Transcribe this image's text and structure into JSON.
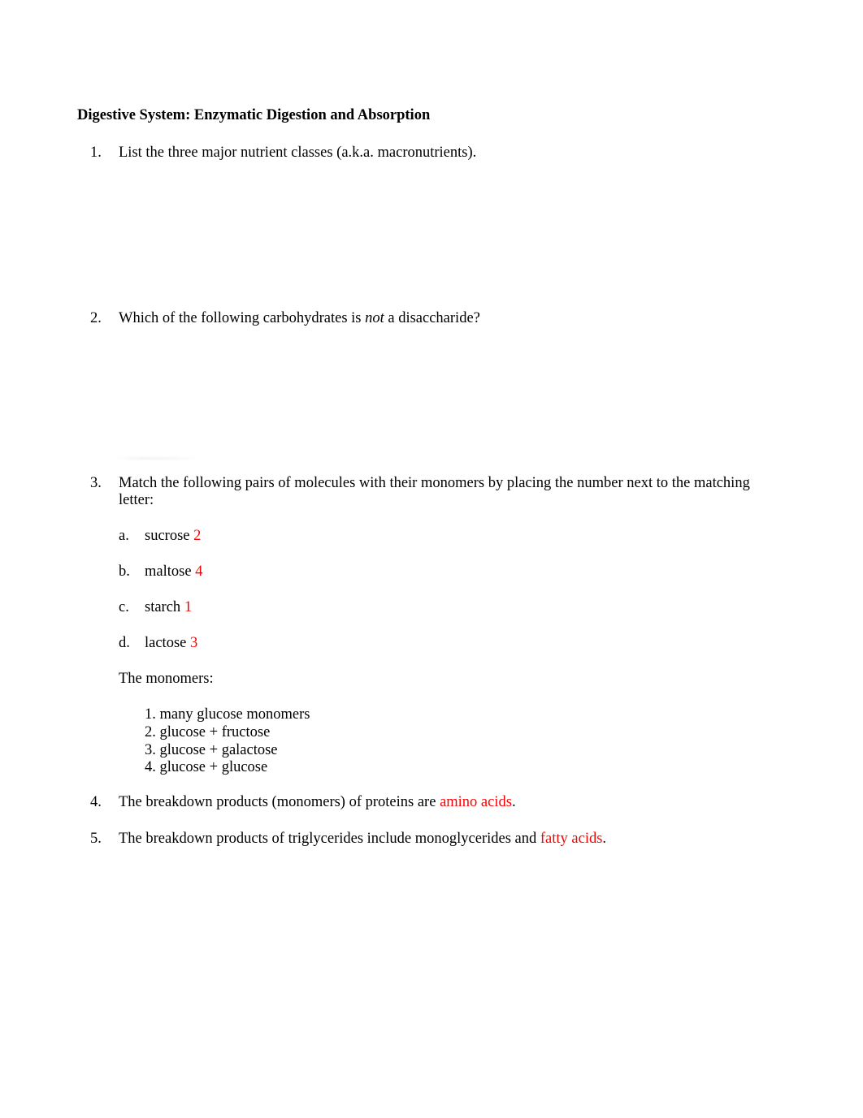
{
  "document": {
    "title": "Digestive System: Enzymatic Digestion and Absorption",
    "questions": [
      {
        "number": "1.",
        "text": "List the three major nutrient classes (a.k.a. macronutrients)."
      },
      {
        "number": "2.",
        "text_before": "Which of the following carbohydrates is ",
        "text_italic": "not",
        "text_after": " a disaccharide?"
      },
      {
        "number": "3.",
        "text_line1": "Match the following pairs of molecules with their monomers by placing the number next to the matching",
        "text_line2": "letter:",
        "items": [
          {
            "letter": "a.",
            "molecule": "sucrose",
            "answer": "2"
          },
          {
            "letter": "b.",
            "molecule": "maltose",
            "answer": "4"
          },
          {
            "letter": "c.",
            "molecule": "starch",
            "answer": "1"
          },
          {
            "letter": "d.",
            "molecule": "lactose",
            "answer": "3"
          }
        ],
        "monomers_label": "The monomers:",
        "monomers": [
          "1. many glucose monomers",
          "2. glucose + fructose",
          "3. glucose + galactose",
          "4. glucose + glucose"
        ]
      },
      {
        "number": "4.",
        "text_before": "The breakdown products (monomers) of proteins are ",
        "answer": "amino acids",
        "text_after": "."
      },
      {
        "number": "5.",
        "text_before": "The breakdown products of triglycerides include monoglycerides and ",
        "answer": "fatty acids",
        "text_after": "."
      }
    ]
  },
  "colors": {
    "answer": "#ff0000",
    "text": "#000000"
  }
}
